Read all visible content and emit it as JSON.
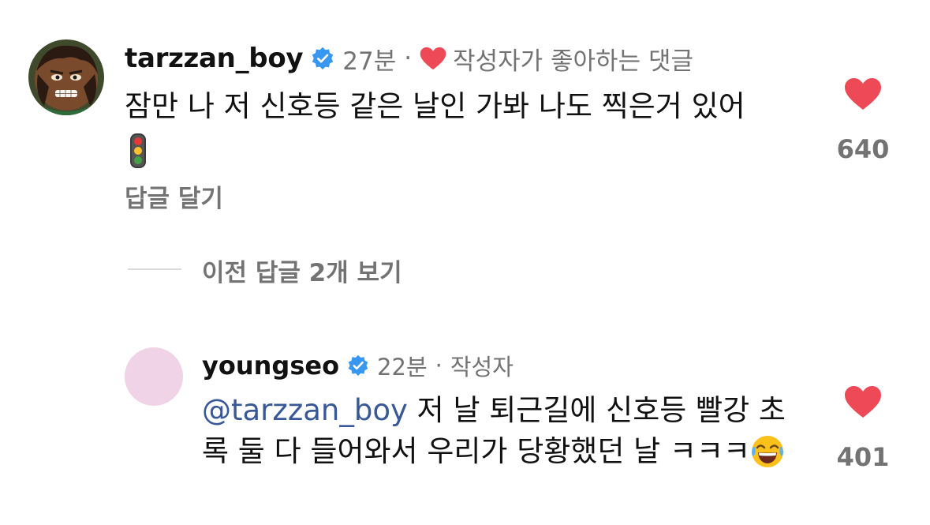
{
  "comment": {
    "username": "tarzzan_boy",
    "time": "27분",
    "separator": "·",
    "creator_liked_label": "작성자가 좋아하는 댓글",
    "text": "잠만 나 저 신호등 같은 날인 가봐 나도 찍은거 있어",
    "emoji": "traffic-light",
    "reply_label": "답글 달기",
    "like_count": "640"
  },
  "view_previous_replies": "이전 답글 2개 보기",
  "reply": {
    "username": "youngseo",
    "time": "22분",
    "separator": "·",
    "author_label": "작성자",
    "mention": "@tarzzan_boy",
    "text": " 저 날 퇴근길에 신호등 빨강 초록 둘 다 들어와서 우리가 당황했던 날 ㅋㅋㅋ",
    "emoji": "laughing-face",
    "like_count": "401",
    "avatar_color": "#f0d3e6"
  },
  "colors": {
    "like_red": "#ed4956",
    "verified_blue": "#3897f0",
    "muted_text": "#737373",
    "mention_blue": "#385898"
  }
}
